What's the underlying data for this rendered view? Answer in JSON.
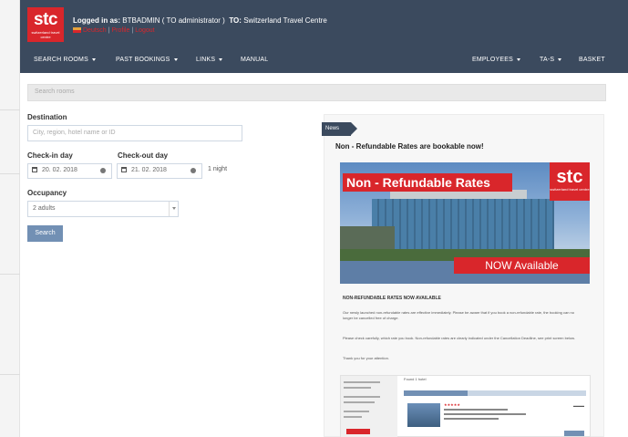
{
  "header": {
    "logo_big": "stc",
    "logo_small": "switzerland travel centre",
    "logged_in_prefix": "Logged in as:",
    "logged_in_user": "BTBADMIN ( TO administrator )",
    "to_prefix": "TO:",
    "to_value": "Switzerland Travel Centre",
    "link_1": "Deutsch",
    "link_2": "Profile",
    "link_3": "Logout"
  },
  "nav": {
    "search_rooms": "SEARCH ROOMS",
    "past_bookings": "PAST BOOKINGS",
    "links": "LINKS",
    "manual": "MANUAL",
    "employees": "EMPLOYEES",
    "tas": "TA-S",
    "basket": "BASKET"
  },
  "search": {
    "placeholder": "Search rooms"
  },
  "form": {
    "destination_label": "Destination",
    "destination_placeholder": "City, region, hotel name or ID",
    "checkin_label": "Check-in day",
    "checkin_value": "20. 02. 2018",
    "checkout_label": "Check-out day",
    "checkout_value": "21. 02. 2018",
    "nights": "1 night",
    "occupancy_label": "Occupancy",
    "occupancy_value": "2 adults",
    "search_button": "Search"
  },
  "news": {
    "tag": "News",
    "title": "Non - Refundable Rates are bookable now!",
    "banner_title": "Non - Refundable Rates",
    "banner_logo_big": "stc",
    "banner_logo_small": "switzerland travel centre",
    "banner_now": "NOW Available",
    "article_head": "NON-REFUNDABLE RATES NOW AVAILABLE",
    "para_1": "Our newly launched non-refundable rates are effective immediately. Please be aware that if you book a non-refundable rate, the booking can no longer be cancelled free of charge.",
    "para_2": "Please check carefully, which rate you book. Non-refundable rates are clearly indicated under the Cancellation Deadline, see print screen below.",
    "para_3": "Thank you for your attention.",
    "preview_found": "Found 1 hotel"
  },
  "colors": {
    "header_bg": "#3b4a5e",
    "brand_red": "#d9262b",
    "button_blue": "#7290b4"
  }
}
